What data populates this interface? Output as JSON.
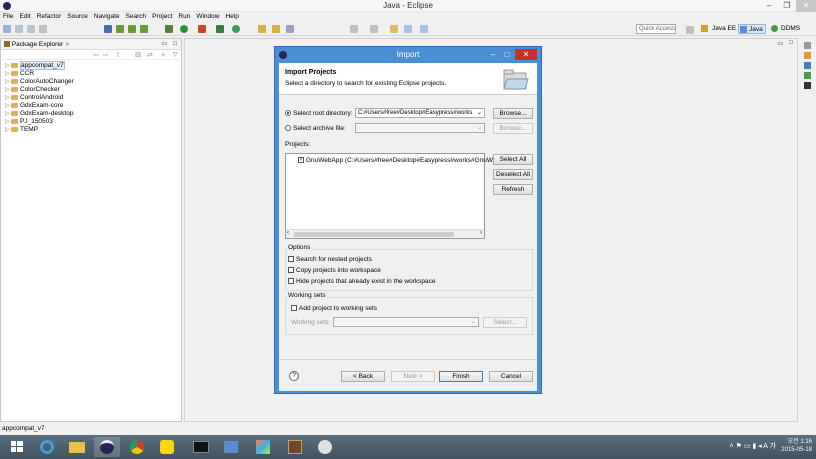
{
  "window": {
    "title": "Java - Eclipse"
  },
  "menu": [
    "File",
    "Edit",
    "Refactor",
    "Source",
    "Navigate",
    "Search",
    "Project",
    "Run",
    "Window",
    "Help"
  ],
  "toolbar": {
    "quick_access": "Quick Access",
    "perspectives": [
      "Java EE",
      "Java",
      "DDMS"
    ]
  },
  "explorer": {
    "title": "Package Explorer",
    "items": [
      "appcompat_v7",
      "CCR",
      "ColorAutoChanger",
      "ColorChecker",
      "ControlAndroid",
      "GdxExam-core",
      "GdxExam-desktop",
      "PJ_150503",
      "TEMP"
    ]
  },
  "dialog": {
    "title": "Import",
    "heading": "Import Projects",
    "description": "Select a directory to search for existing Eclipse projects.",
    "root_dir_label": "Select root directory:",
    "root_dir_value": "C:#Users#free#Desktop#Easypress#works",
    "archive_label": "Select archive file:",
    "browse": "Browse...",
    "projects_label": "Projects:",
    "project_item": "GnuWebApp (C:#Users#free#Desktop#Easypress#works#GnuW",
    "select_all": "Select All",
    "deselect_all": "Deselect All",
    "refresh": "Refresh",
    "options_label": "Options",
    "opt_nested": "Search for nested projects",
    "opt_copy": "Copy projects into workspace",
    "opt_hide": "Hide projects that already exist in the workspace",
    "working_sets_label": "Working sets",
    "add_ws": "Add project to working sets",
    "ws_label": "Working sets:",
    "select": "Select...",
    "back": "< Back",
    "next": "Next >",
    "finish": "Finish",
    "cancel": "Cancel",
    "help": "?"
  },
  "status": {
    "text": "appcompat_v7"
  },
  "taskbar": {
    "time": "오전 1:16",
    "date": "2015-05-18",
    "lang": "A",
    "ime": "가"
  },
  "colors": {
    "dialog_border": "#4a8fd6",
    "close": "#c9302c",
    "taskbar": "#4a5b68"
  }
}
